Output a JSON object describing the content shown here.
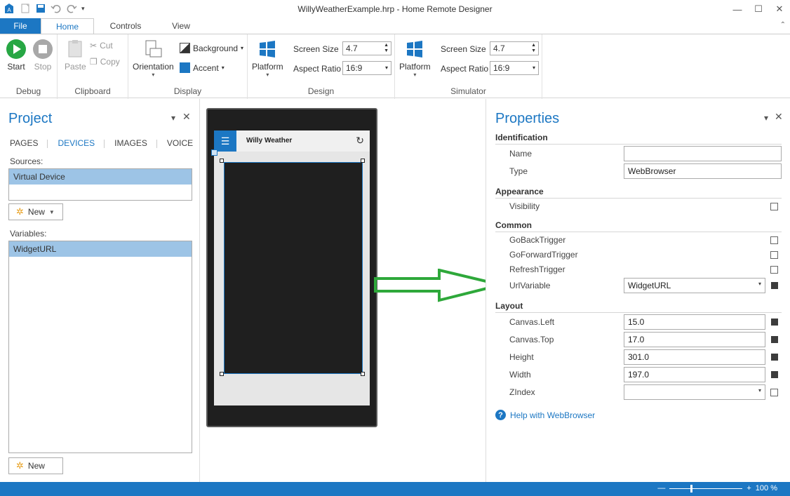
{
  "window": {
    "title": "WillyWeatherExample.hrp - Home Remote Designer"
  },
  "tabs": {
    "file": "File",
    "home": "Home",
    "controls": "Controls",
    "view": "View"
  },
  "ribbon": {
    "debug": {
      "start": "Start",
      "stop": "Stop",
      "label": "Debug"
    },
    "clipboard": {
      "paste": "Paste",
      "cut": "Cut",
      "copy": "Copy",
      "label": "Clipboard"
    },
    "display": {
      "orientation": "Orientation",
      "background": "Background",
      "accent": "Accent",
      "label": "Display"
    },
    "design": {
      "platform": "Platform",
      "screen_size_label": "Screen Size",
      "screen_size": "4.7",
      "aspect_label": "Aspect Ratio",
      "aspect": "16:9",
      "label": "Design"
    },
    "simulator": {
      "platform": "Platform",
      "screen_size_label": "Screen Size",
      "screen_size": "4.7",
      "aspect_label": "Aspect Ratio",
      "aspect": "16:9",
      "label": "Simulator"
    }
  },
  "project": {
    "title": "Project",
    "tabs": [
      "PAGES",
      "DEVICES",
      "IMAGES",
      "VOICE"
    ],
    "sources_label": "Sources:",
    "sources": [
      "Virtual Device"
    ],
    "new_label": "New",
    "variables_label": "Variables:",
    "variables": [
      "WidgetURL"
    ]
  },
  "device": {
    "app_title": "Willy Weather"
  },
  "properties": {
    "title": "Properties",
    "identification": "Identification",
    "name_label": "Name",
    "name_value": "",
    "type_label": "Type",
    "type_value": "WebBrowser",
    "appearance": "Appearance",
    "visibility_label": "Visibility",
    "common": "Common",
    "goback_label": "GoBackTrigger",
    "goforward_label": "GoForwardTrigger",
    "refresh_label": "RefreshTrigger",
    "urlvar_label": "UrlVariable",
    "urlvar_value": "WidgetURL",
    "layout": "Layout",
    "left_label": "Canvas.Left",
    "left_value": "15.0",
    "top_label": "Canvas.Top",
    "top_value": "17.0",
    "height_label": "Height",
    "height_value": "301.0",
    "width_label": "Width",
    "width_value": "197.0",
    "zindex_label": "ZIndex",
    "zindex_value": "",
    "help": "Help with WebBrowser"
  },
  "status": {
    "zoom": "100 %"
  },
  "colors": {
    "accent": "#1c77c3",
    "arrow": "#2ea83a",
    "start": "#27a744"
  }
}
